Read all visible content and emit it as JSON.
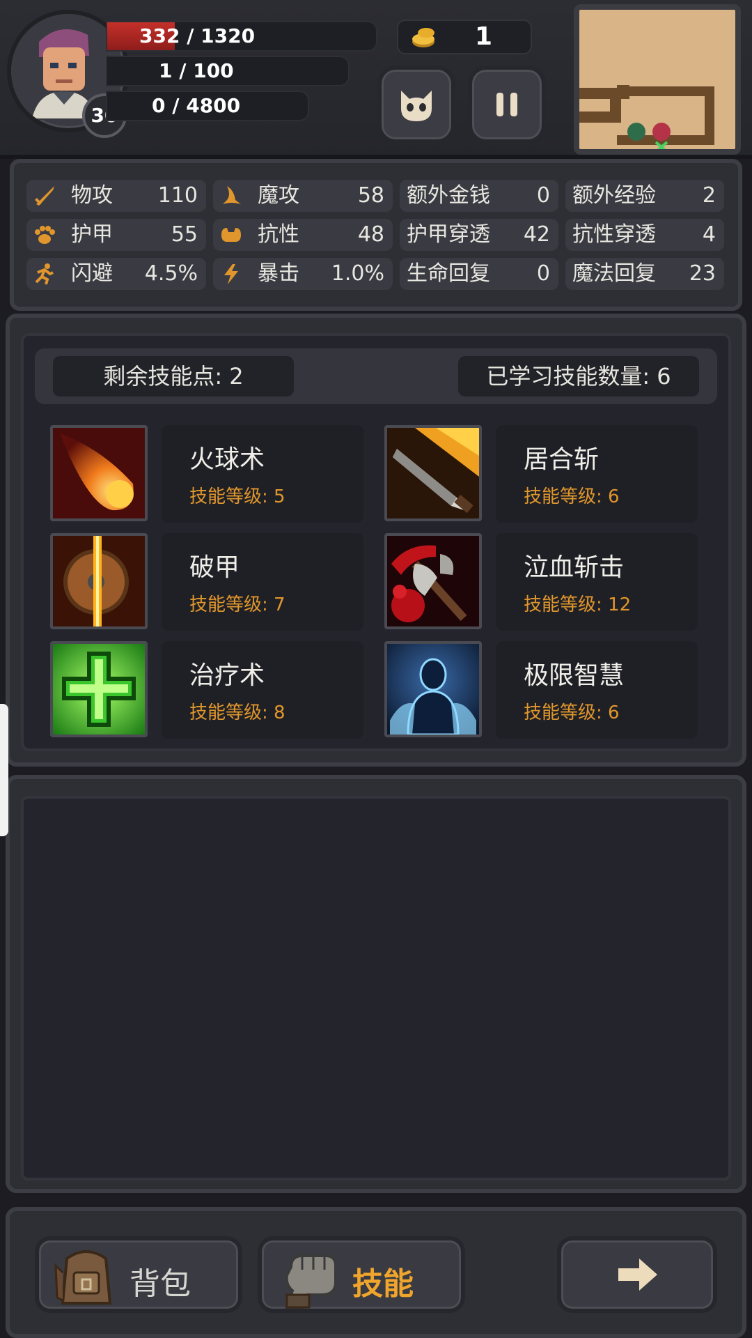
{
  "player": {
    "level": "30",
    "hp_text": "332 / 1320",
    "hp_fraction": 0.2515,
    "mp_text": "1 / 100",
    "xp_text": "0 / 4800"
  },
  "gold": "1",
  "colors": {
    "accent": "#e0962c",
    "hp": "#c4302a",
    "panel": "#2e2f35",
    "map": "#d8b487"
  },
  "stats": [
    {
      "label": "物攻",
      "value": "110",
      "icon": "sword-icon"
    },
    {
      "label": "魔攻",
      "value": "58",
      "icon": "wizard-hat-icon"
    },
    {
      "label": "额外金钱",
      "value": "0"
    },
    {
      "label": "额外经验",
      "value": "2"
    },
    {
      "label": "护甲",
      "value": "55",
      "icon": "paw-armor-icon"
    },
    {
      "label": "抗性",
      "value": "48",
      "icon": "muscle-icon"
    },
    {
      "label": "护甲穿透",
      "value": "42"
    },
    {
      "label": "抗性穿透",
      "value": "4"
    },
    {
      "label": "闪避",
      "value": "4.5%",
      "icon": "running-icon"
    },
    {
      "label": "暴击",
      "value": "1.0%",
      "icon": "lightning-icon"
    },
    {
      "label": "生命回复",
      "value": "0"
    },
    {
      "label": "魔法回复",
      "value": "23"
    }
  ],
  "skills_header": {
    "remaining_points": "剩余技能点: 2",
    "learned_count": "已学习技能数量: 6"
  },
  "skills": [
    {
      "name": "火球术",
      "level": "技能等级: 5",
      "icon": "fireball-icon"
    },
    {
      "name": "居合斩",
      "level": "技能等级: 6",
      "icon": "flaming-sword-icon"
    },
    {
      "name": "破甲",
      "level": "技能等级: 7",
      "icon": "split-shield-icon"
    },
    {
      "name": "泣血斩击",
      "level": "技能等级: 12",
      "icon": "bloody-axe-icon"
    },
    {
      "name": "治疗术",
      "level": "技能等级: 8",
      "icon": "green-cross-icon"
    },
    {
      "name": "极限智慧",
      "level": "技能等级: 6",
      "icon": "spirit-figure-icon"
    }
  ],
  "nav": {
    "backpack": "背包",
    "skills": "技能"
  }
}
